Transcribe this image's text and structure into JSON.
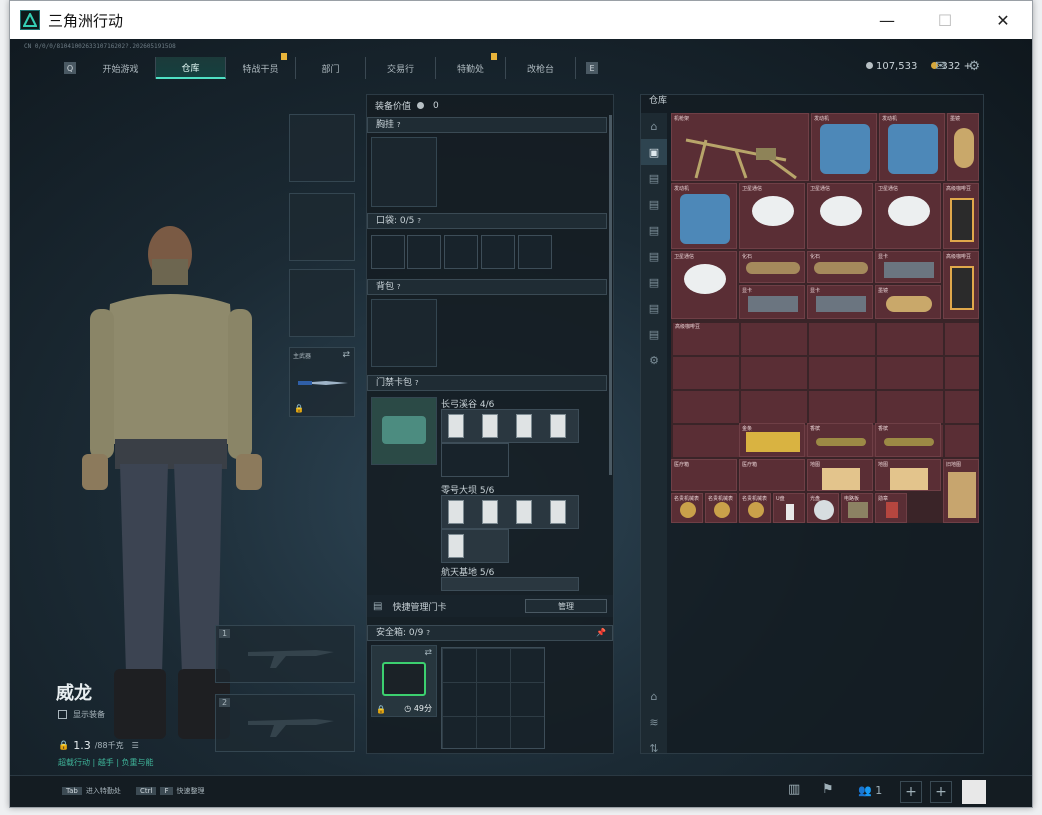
{
  "window": {
    "title": "三角洲行动",
    "controls": [
      "—",
      "☐",
      "✕"
    ]
  },
  "version_line": "CN 0/0/0/8104100263310716202?.2026051915O8",
  "nav": {
    "left_key": "Q",
    "right_key": "E",
    "tabs": [
      {
        "label": "开始游戏",
        "active": false,
        "badge": false
      },
      {
        "label": "仓库",
        "active": true,
        "badge": false
      },
      {
        "label": "特战干员",
        "active": false,
        "badge": true
      },
      {
        "label": "部门",
        "active": false,
        "badge": false
      },
      {
        "label": "交易行",
        "active": false,
        "badge": false
      },
      {
        "label": "特勤处",
        "active": false,
        "badge": true
      },
      {
        "label": "改枪台",
        "active": false,
        "badge": false
      }
    ]
  },
  "currency": {
    "coins": "107,533",
    "gold": "332",
    "gold_plus": "+"
  },
  "character": {
    "name": "威龙",
    "show_gear_label": "显示装备",
    "weight": "1.3",
    "weight_capacity": "/88千克",
    "status": "超载行动 | 越手 | 负重与能"
  },
  "equipment": {
    "value_label": "装备价值",
    "value": "0",
    "chest_label": "胸挂",
    "pockets_label": "口袋:",
    "pockets_value": "0/5",
    "backpack_label": "背包",
    "keycard_bag_label": "门禁卡包",
    "keycards": [
      {
        "name": "长弓溪谷",
        "count": "4/6"
      },
      {
        "name": "零号大坝",
        "count": "5/6"
      },
      {
        "name": "航天基地",
        "count": "5/6"
      }
    ],
    "quick_manage_label": "快捷管理门卡",
    "manage_button": "管理",
    "safebox_label": "安全箱:",
    "safebox_value": "0/9",
    "safebox_timer": "49分",
    "weapon_slot_label": "主武器"
  },
  "storage": {
    "title": "仓库",
    "items": [
      {
        "label": "机枪架"
      },
      {
        "label": "发动机"
      },
      {
        "label": "发动机"
      },
      {
        "label": "墨镜"
      },
      {
        "label": "发动机"
      },
      {
        "label": "卫星通信"
      },
      {
        "label": "卫星通信"
      },
      {
        "label": "卫星通信"
      },
      {
        "label": "高级咖啡豆"
      },
      {
        "label": "卫星通信"
      },
      {
        "label": "化石"
      },
      {
        "label": "化石"
      },
      {
        "label": "显卡"
      },
      {
        "label": "高级咖啡豆"
      },
      {
        "label": "显卡"
      },
      {
        "label": "显卡"
      },
      {
        "label": "墨镜"
      },
      {
        "label": "高级咖啡豆"
      },
      {
        "label": "金条"
      },
      {
        "label": "香槟"
      },
      {
        "label": "香槟"
      },
      {
        "label": "医疗箱"
      },
      {
        "label": "医疗箱"
      },
      {
        "label": "地图"
      },
      {
        "label": "地图"
      },
      {
        "label": "旧地图"
      },
      {
        "label": "名贵机械表"
      },
      {
        "label": "名贵机械表"
      },
      {
        "label": "名贵机械表"
      },
      {
        "label": "U盘"
      },
      {
        "label": "光盘"
      },
      {
        "label": "电路板"
      },
      {
        "label": "勋章"
      }
    ]
  },
  "bottom": {
    "tab_key": "Tab",
    "tab_hint": "进入特勤处",
    "ctrl_key": "Ctrl",
    "f_key": "F",
    "ctrl_hint": "快速整理",
    "friends_count": "1"
  },
  "colors": {
    "accent": "#4fe0c4",
    "item_bg": "#5a2e35",
    "gold": "#d6a73b"
  }
}
